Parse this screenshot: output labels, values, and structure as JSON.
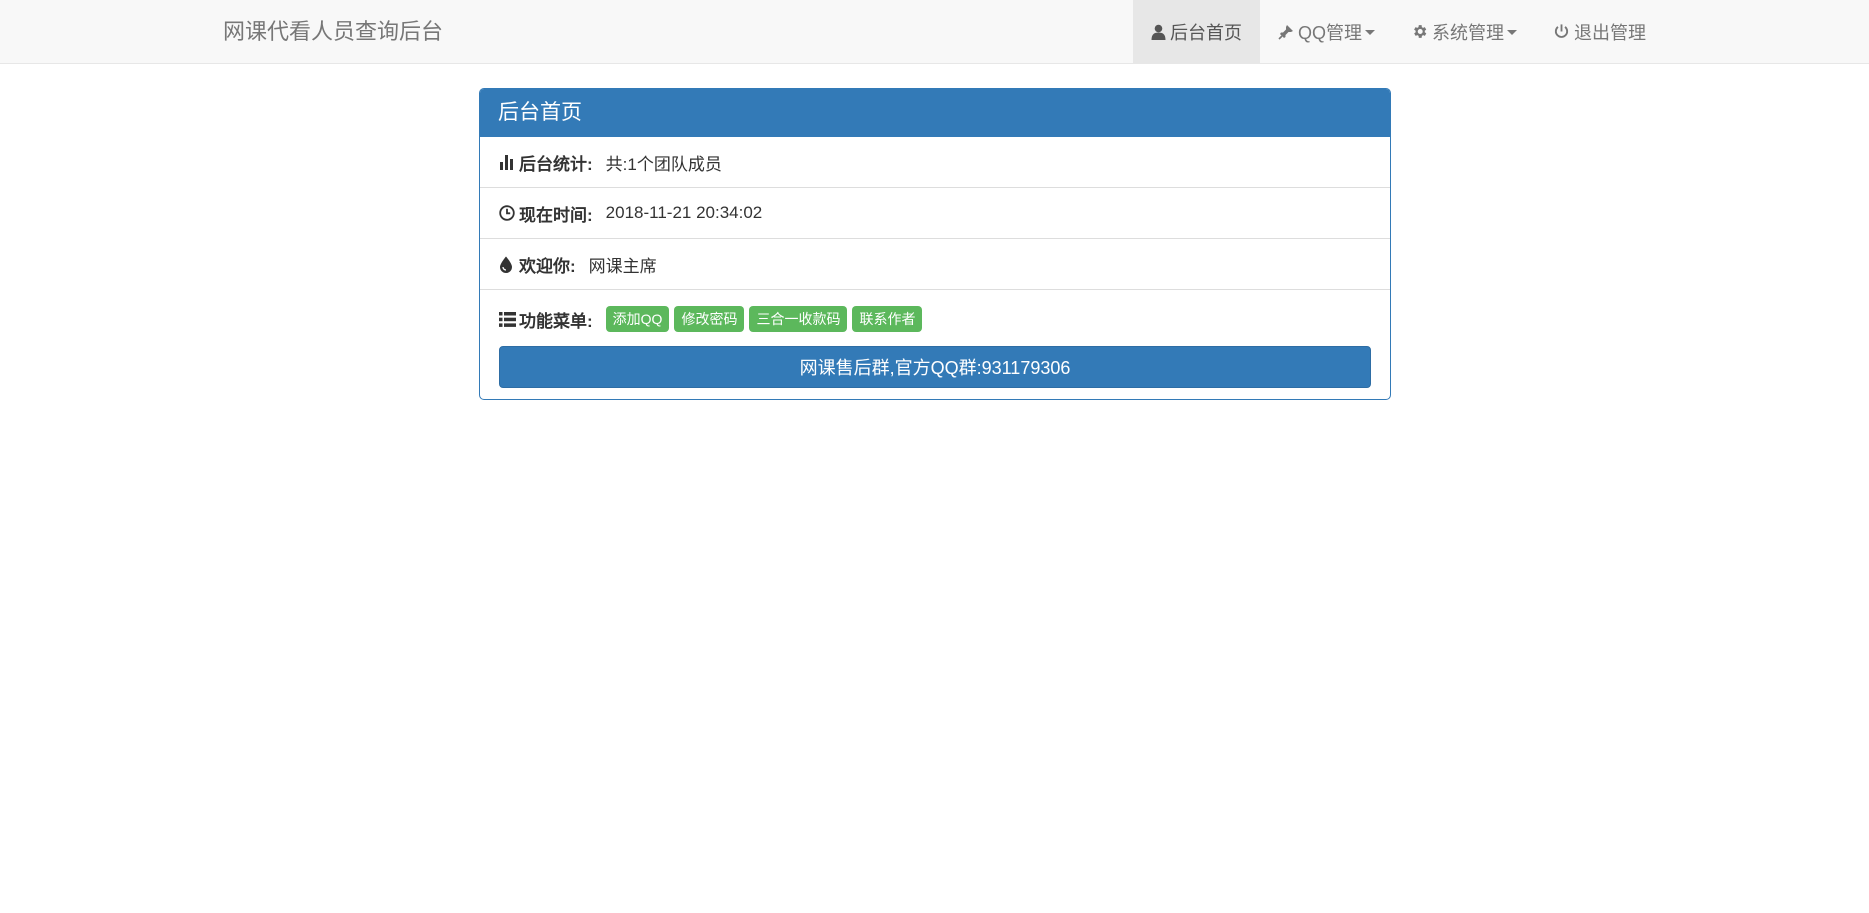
{
  "navbar": {
    "brand": "网课代看人员查询后台",
    "items": [
      {
        "label": "后台首页",
        "icon": "user-icon",
        "active": true
      },
      {
        "label": "QQ管理",
        "icon": "pushpin-icon",
        "dropdown": true
      },
      {
        "label": "系统管理",
        "icon": "gear-icon",
        "dropdown": true
      },
      {
        "label": "退出管理",
        "icon": "power-icon"
      }
    ]
  },
  "panel": {
    "title": "后台首页",
    "stats": {
      "label": "后台统计:",
      "value": "共:1个团队成员",
      "icon": "bar-chart-icon"
    },
    "time": {
      "label": "现在时间:",
      "value": "2018-11-21 20:34:02",
      "icon": "clock-icon"
    },
    "welcome": {
      "label": "欢迎你:",
      "value": "网课主席",
      "icon": "tint-drop-icon"
    },
    "menu": {
      "label": "功能菜单:",
      "icon": "list-icon",
      "buttons": [
        "添加QQ",
        "修改密码",
        "三合一收款码",
        "联系作者"
      ]
    },
    "group_button": "网课售后群,官方QQ群:931179306"
  },
  "colors": {
    "primary": "#337ab7",
    "success": "#5cb85c",
    "navbar_bg": "#f8f8f8",
    "nav_active_bg": "#e7e7e7",
    "nav_text": "#777777"
  }
}
